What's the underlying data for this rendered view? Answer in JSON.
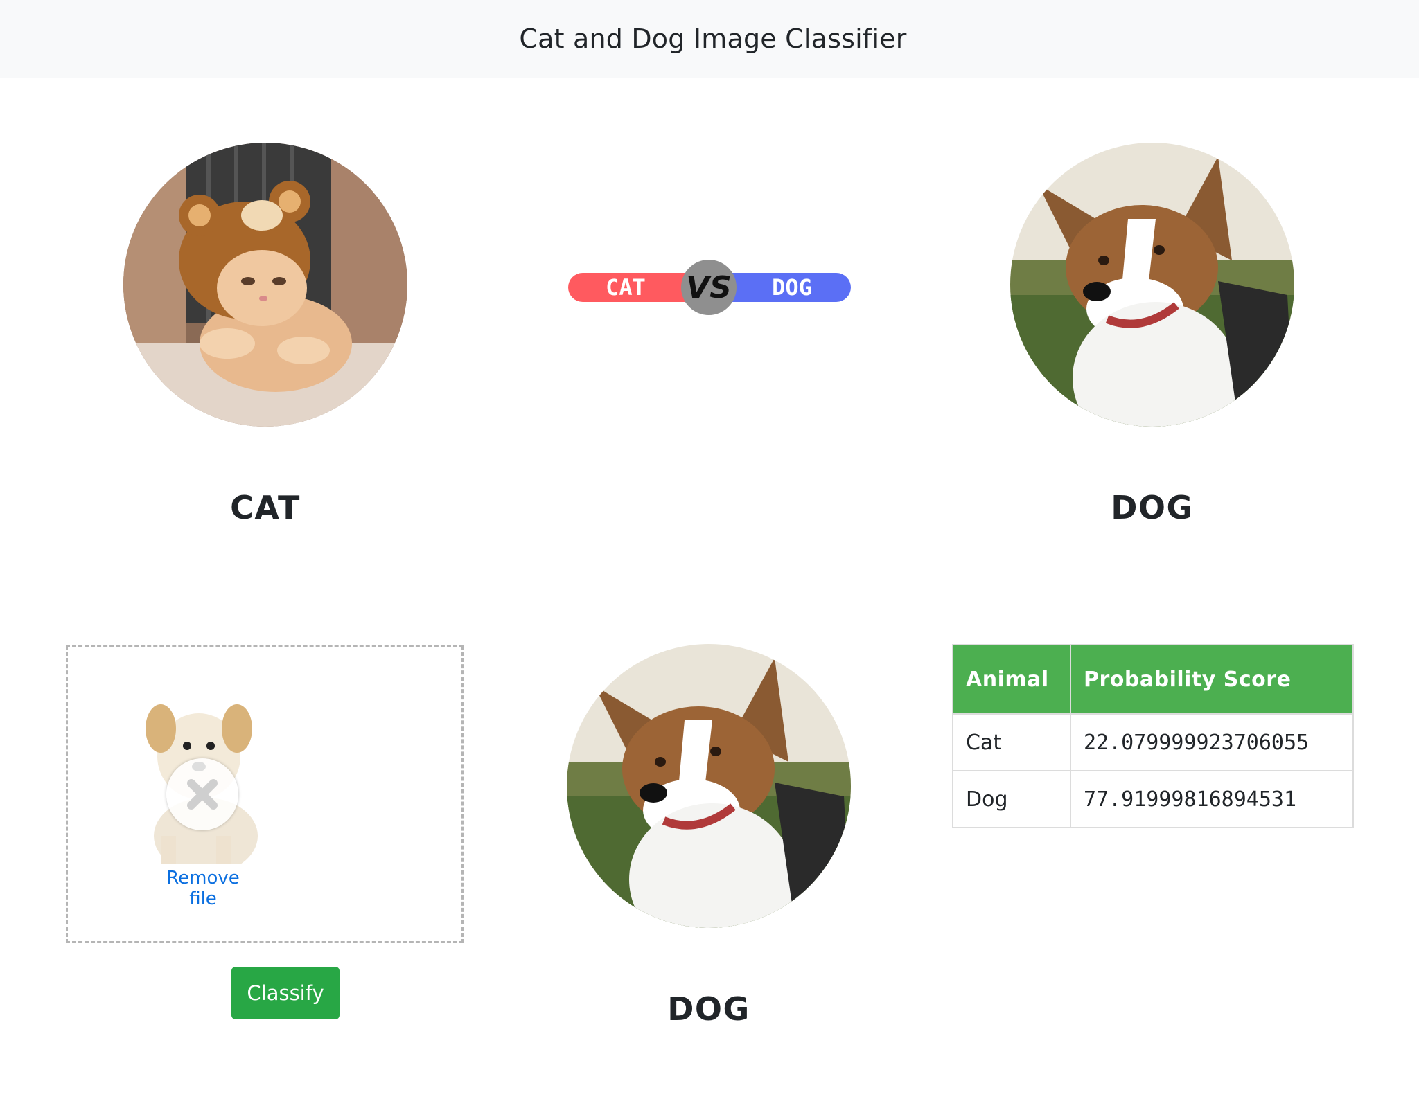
{
  "navbar": {
    "title": "Cat and Dog Image Classifier"
  },
  "gallery": {
    "left_label": "CAT",
    "right_label": "DOG",
    "banner_left_text": "CAT",
    "banner_center_text": "VS",
    "banner_right_text": "DOG"
  },
  "upload": {
    "remove_label": "Remove file",
    "classify_label": "Classify"
  },
  "prediction": {
    "label": "DOG"
  },
  "results_table": {
    "headers": [
      "Animal",
      "Probability Score"
    ],
    "rows": [
      {
        "animal": "Cat",
        "score": "22.079999923706055"
      },
      {
        "animal": "Dog",
        "score": "77.91999816894531"
      }
    ]
  },
  "colors": {
    "cat_red": "#ff5a5f",
    "dog_blue": "#5b6ff5",
    "classify_green": "#28a745",
    "table_header_green": "#4caf50",
    "link_blue": "#0b6fe0"
  }
}
